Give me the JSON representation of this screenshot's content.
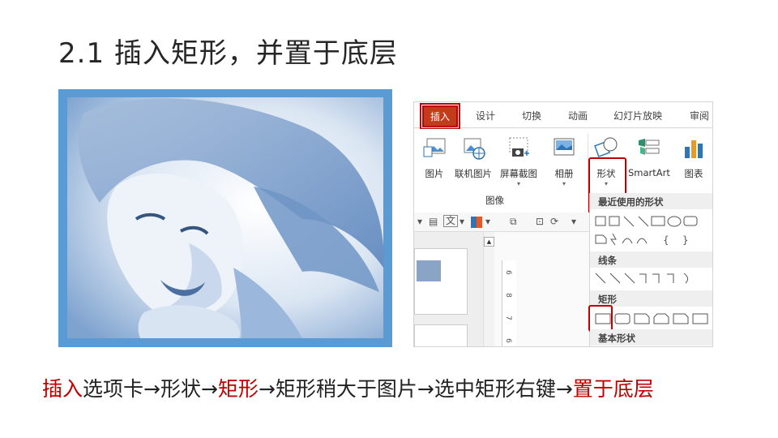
{
  "slide": {
    "title": "2.1 插入矩形，并置于底层"
  },
  "ribbon": {
    "tabs": [
      "插入",
      "设计",
      "切换",
      "动画",
      "幻灯片放映",
      "审阅"
    ],
    "buttons": {
      "picture": "图片",
      "online_picture": "联机图片",
      "screenshot": "屏幕截图",
      "album": "相册",
      "shapes": "形状",
      "smartart": "SmartArt",
      "chart": "图表"
    },
    "group_label": "图像"
  },
  "shapes_panel": {
    "recent": "最近使用的形状",
    "lines": "线条",
    "rectangles": "矩形",
    "basic": "基本形状"
  },
  "toolbar2": {
    "text_icon": "文"
  },
  "ruler": [
    "6",
    "8",
    "7",
    "6"
  ],
  "caption": {
    "p1": "插入",
    "p2": "选项卡→形状→",
    "p3": "矩形",
    "p4": "→矩形稍大于图片→选中矩形右键→",
    "p5": "置于底层"
  },
  "colors": {
    "accent_red": "#c00000",
    "frame_blue": "#5b9bd5"
  }
}
